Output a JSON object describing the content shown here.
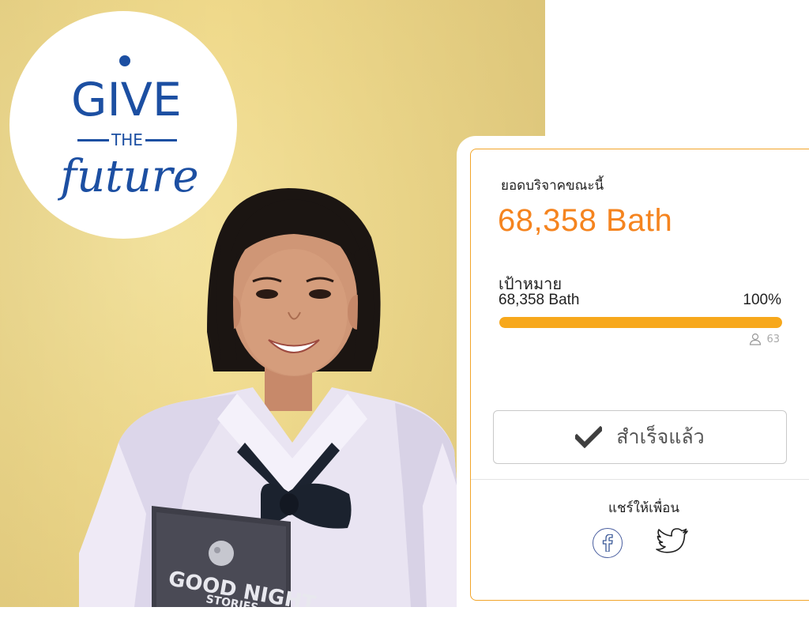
{
  "logo": {
    "word_top": "GIVE",
    "word_middle": "THE",
    "word_bottom": "future"
  },
  "book": {
    "title": "GOOD NIGHT",
    "subtitle": "STORIES"
  },
  "donation": {
    "raised_label": "ยอดบริจาคขณะนี้",
    "raised_amount": "68,358 Bath",
    "goal_label": "เป้าหมาย",
    "goal_amount": "68,358 Bath",
    "progress_percent_text": "100%",
    "progress_fraction": 1.0,
    "donor_count": "63",
    "status_button_label": "สำเร็จแล้ว",
    "share_label": "แชร์ให้เพื่อน"
  },
  "icons": {
    "check": "check-icon",
    "user": "user-icon",
    "facebook": "facebook-icon",
    "twitter": "twitter-icon"
  },
  "colors": {
    "accent_orange": "#f5841f",
    "progress": "#f7a81c",
    "card_border": "#f2a52a",
    "logo_blue": "#1c4fa2",
    "wall_yellow": "#efd98b"
  }
}
